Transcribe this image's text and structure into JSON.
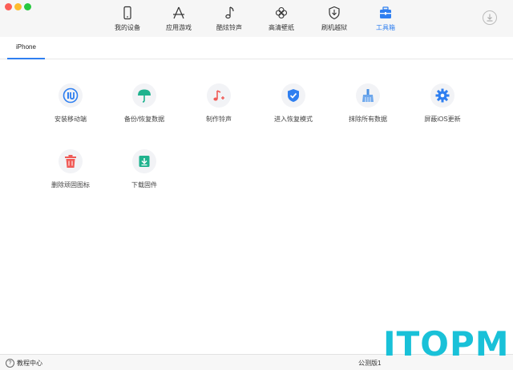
{
  "window": {
    "traffic_lights": [
      "close",
      "minimize",
      "zoom"
    ]
  },
  "nav": {
    "tabs": [
      {
        "label": "我的设备",
        "icon": "phone-icon"
      },
      {
        "label": "应用游戏",
        "icon": "appstore-icon"
      },
      {
        "label": "酷炫铃声",
        "icon": "music-note-icon"
      },
      {
        "label": "高清壁纸",
        "icon": "flower-icon"
      },
      {
        "label": "刷机越狱",
        "icon": "shield-download-icon"
      },
      {
        "label": "工具箱",
        "icon": "toolbox-icon",
        "active": true
      }
    ],
    "download_icon": "download-icon"
  },
  "subtabs": [
    {
      "label": "iPhone",
      "active": true
    }
  ],
  "tools": [
    {
      "label": "安装移动端",
      "icon": "itools-logo-icon",
      "color": "#2f7ff0"
    },
    {
      "label": "备份/恢复数据",
      "icon": "umbrella-icon",
      "color": "#1fb28e"
    },
    {
      "label": "制作铃声",
      "icon": "music-plus-icon",
      "color": "#f05b57"
    },
    {
      "label": "进入恢复模式",
      "icon": "shield-check-icon",
      "color": "#2f7ff0"
    },
    {
      "label": "抹除所有数据",
      "icon": "broom-icon",
      "color": "#4a90e2"
    },
    {
      "label": "屏蔽iOS更新",
      "icon": "gear-icon",
      "color": "#2f7ff0"
    },
    {
      "label": "删除顽固图标",
      "icon": "trash-icon",
      "color": "#f05b57"
    },
    {
      "label": "下载固件",
      "icon": "download-box-icon",
      "color": "#1fb28e"
    }
  ],
  "status": {
    "help_label": "教程中心",
    "version": "公测版1"
  },
  "watermark": "ITOPM",
  "colors": {
    "accent": "#2f7ff0",
    "green": "#1fb28e",
    "red": "#f05b57",
    "watermark": "#19c1d8"
  }
}
